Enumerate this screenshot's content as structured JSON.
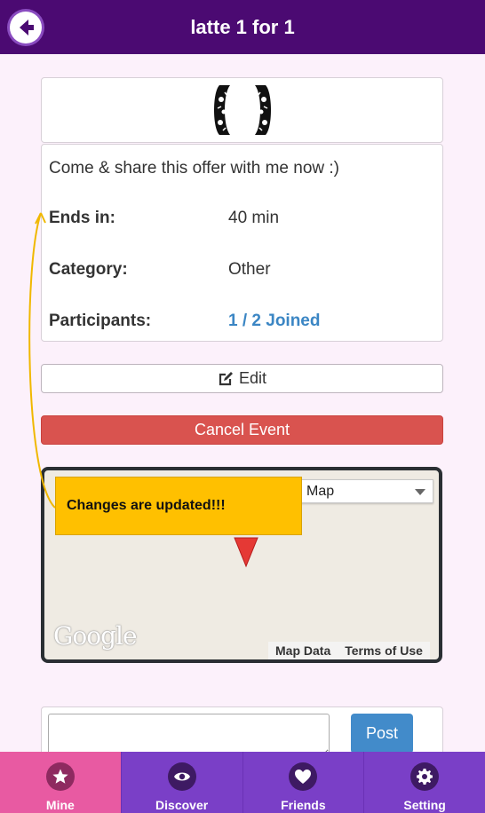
{
  "header": {
    "title": "latte 1 for 1"
  },
  "event": {
    "description": "Come & share this offer with me now :)",
    "ends_in_label": "Ends in:",
    "ends_in_value": "40 min",
    "category_label": "Category:",
    "category_value": "Other",
    "participants_label": "Participants:",
    "participants_value": "1 / 2 Joined"
  },
  "actions": {
    "edit_label": "Edit",
    "cancel_label": "Cancel Event"
  },
  "map": {
    "type_select": "Map",
    "logo_text": "Google",
    "map_data_link": "Map Data",
    "terms_link": "Terms of Use"
  },
  "toast": {
    "message": "Changes are updated!!!"
  },
  "comment": {
    "post_label": "Post"
  },
  "nav": {
    "items": [
      {
        "label": "Mine",
        "icon": "star-icon"
      },
      {
        "label": "Discover",
        "icon": "eye-icon"
      },
      {
        "label": "Friends",
        "icon": "heart-icon"
      },
      {
        "label": "Setting",
        "icon": "gear-icon"
      }
    ]
  },
  "colors": {
    "header_bg": "#4b0a72",
    "accent_purple": "#7a3fc7",
    "active_tab": "#e85aa2",
    "danger": "#d9534f",
    "primary_blue": "#428bca",
    "link_blue": "#3b86c4",
    "toast_bg": "#ffc000"
  }
}
